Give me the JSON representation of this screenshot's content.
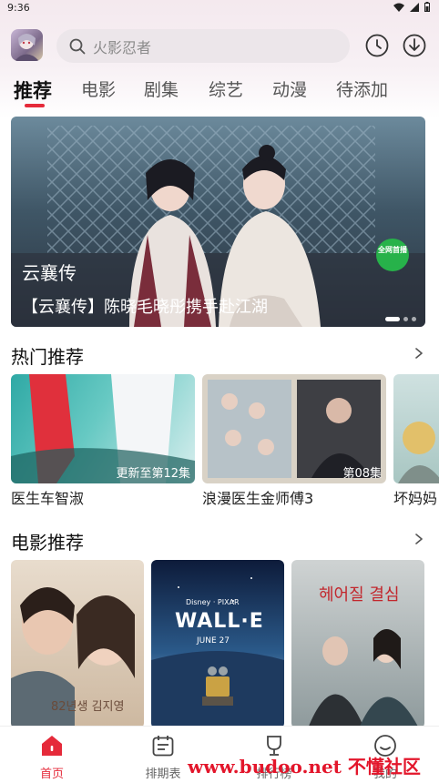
{
  "status": {
    "time": "9:36"
  },
  "search": {
    "placeholder": "火影忍者"
  },
  "tabs": [
    "推荐",
    "电影",
    "剧集",
    "综艺",
    "动漫",
    "待添加"
  ],
  "banner": {
    "logo": "云襄传",
    "badge": "全网首播",
    "caption": "【云襄传】陈晓毛晓彤携手赴江湖"
  },
  "hot": {
    "title": "热门推荐",
    "items": [
      {
        "title": "医生车智淑",
        "episode": "更新至第12集"
      },
      {
        "title": "浪漫医生金师傅3",
        "episode": "第08集"
      },
      {
        "title": "坏妈妈",
        "episode": ""
      }
    ]
  },
  "movies": {
    "title": "电影推荐",
    "items": [
      {
        "poster_text": "82년생 김지영"
      },
      {
        "poster_text": "WALL·E",
        "poster_sub": "JUNE 27",
        "studio": "Disney · PIXAR"
      },
      {
        "poster_text": "헤어질 결심"
      }
    ]
  },
  "nav": [
    "首页",
    "排期表",
    "排行榜",
    "我的"
  ],
  "watermark": "www.budoo.net 不懂社区",
  "colors": {
    "accent": "#e52a3a",
    "badge_green": "#27b24a"
  }
}
